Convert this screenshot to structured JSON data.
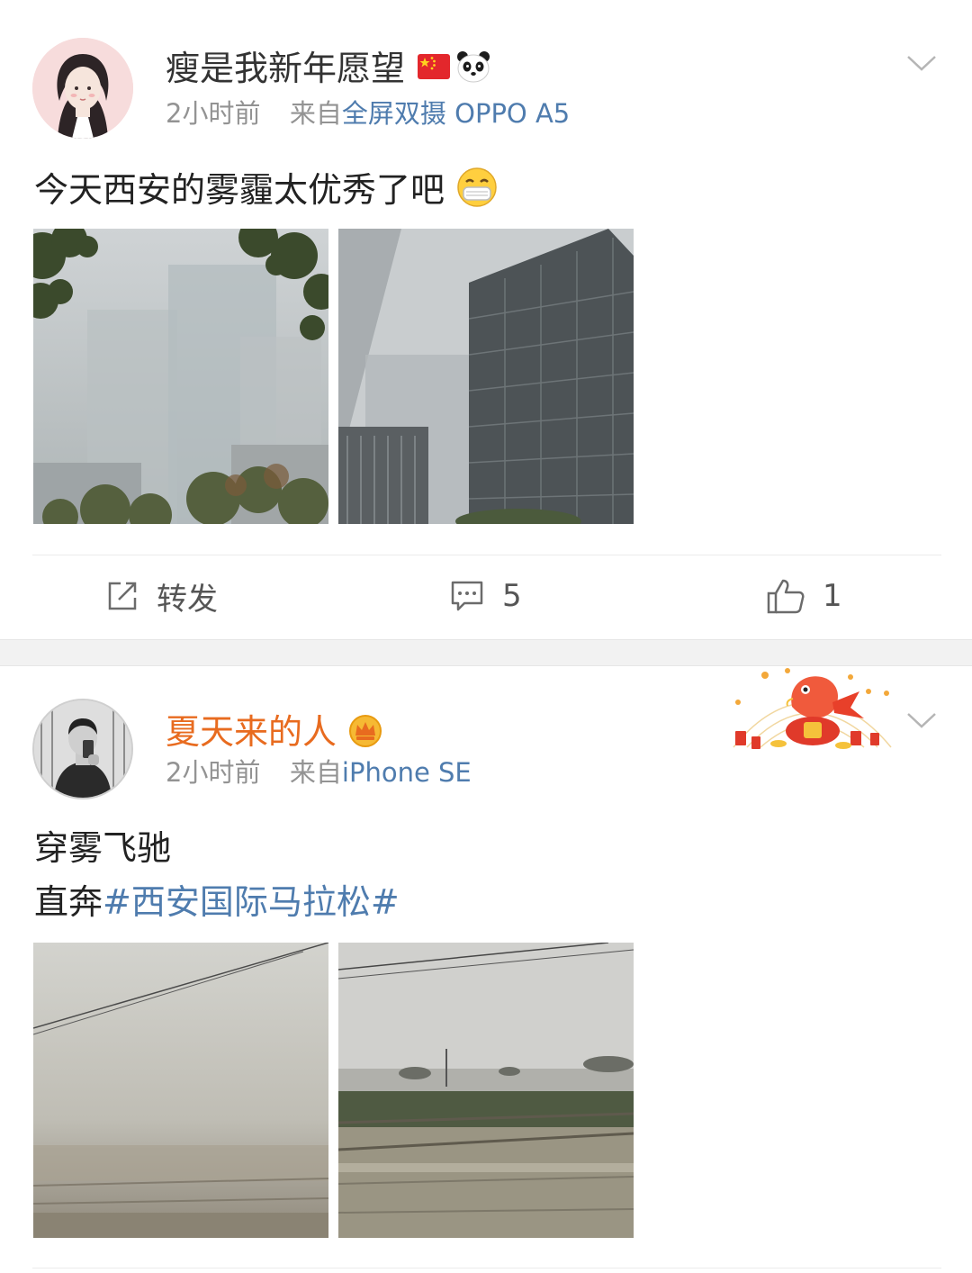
{
  "posts": [
    {
      "user": {
        "name": "瘦是我新年愿望",
        "badges": [
          "china-flag-emoji",
          "panda-emoji"
        ]
      },
      "meta": {
        "time": "2小时前",
        "source_prefix": "来自",
        "source": "全屏双摄 OPPO A5"
      },
      "text": "今天西安的雾霾太优秀了吧",
      "emoji": "mask-face-emoji",
      "images": [
        "foggy-high-rise-with-trees",
        "foggy-glass-office-towers"
      ],
      "actions": {
        "repost_label": "转发",
        "comment_count": "5",
        "like_count": "1"
      }
    },
    {
      "user": {
        "name": "夏天来的人",
        "badges": [
          "vip-crown-badge"
        ]
      },
      "meta": {
        "time": "2小时前",
        "source_prefix": "来自",
        "source": "iPhone SE"
      },
      "text_lines": [
        "穿雾飞驰",
        "直奔"
      ],
      "topic": "#西安国际马拉松#",
      "images": [
        "foggy-view-from-train-window",
        "foggy-riverside-from-train"
      ],
      "decoration": "new-year-koi-fish-card"
    }
  ],
  "colors": {
    "link": "#4f7cae",
    "vip_name": "#e86b1f",
    "meta_gray": "#939393",
    "band": "#f2f2f2"
  }
}
